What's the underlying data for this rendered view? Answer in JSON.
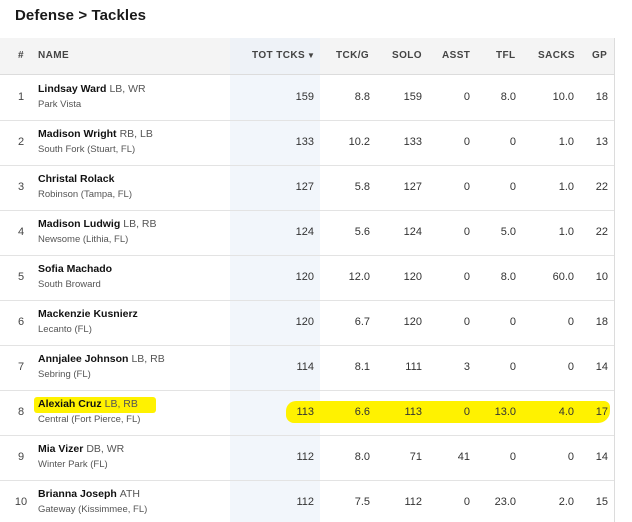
{
  "page": {
    "title": "Defense > Tackles"
  },
  "table": {
    "headers": {
      "rank": "#",
      "name": "NAME",
      "tot": "TOT TCKS",
      "sort_glyph": "▼",
      "tckg": "TCK/G",
      "solo": "SOLO",
      "asst": "ASST",
      "tfl": "TFL",
      "sacks": "SACKS",
      "gp": "GP"
    },
    "rows": [
      {
        "rank": "1",
        "name": "Lindsay Ward",
        "pos": "LB, WR",
        "school": "Park Vista",
        "tot": "159",
        "tckg": "8.8",
        "solo": "159",
        "asst": "0",
        "tfl": "8.0",
        "sacks": "10.0",
        "gp": "18"
      },
      {
        "rank": "2",
        "name": "Madison Wright",
        "pos": "RB, LB",
        "school": "South Fork (Stuart, FL)",
        "tot": "133",
        "tckg": "10.2",
        "solo": "133",
        "asst": "0",
        "tfl": "0",
        "sacks": "1.0",
        "gp": "13"
      },
      {
        "rank": "3",
        "name": "Christal Rolack",
        "pos": "",
        "school": "Robinson (Tampa, FL)",
        "tot": "127",
        "tckg": "5.8",
        "solo": "127",
        "asst": "0",
        "tfl": "0",
        "sacks": "1.0",
        "gp": "22"
      },
      {
        "rank": "4",
        "name": "Madison Ludwig",
        "pos": "LB, RB",
        "school": "Newsome (Lithia, FL)",
        "tot": "124",
        "tckg": "5.6",
        "solo": "124",
        "asst": "0",
        "tfl": "5.0",
        "sacks": "1.0",
        "gp": "22"
      },
      {
        "rank": "5",
        "name": "Sofia Machado",
        "pos": "",
        "school": "South Broward",
        "tot": "120",
        "tckg": "12.0",
        "solo": "120",
        "asst": "0",
        "tfl": "8.0",
        "sacks": "60.0",
        "gp": "10"
      },
      {
        "rank": "6",
        "name": "Mackenzie Kusnierz",
        "pos": "",
        "school": "Lecanto (FL)",
        "tot": "120",
        "tckg": "6.7",
        "solo": "120",
        "asst": "0",
        "tfl": "0",
        "sacks": "0",
        "gp": "18"
      },
      {
        "rank": "7",
        "name": "Annjalee Johnson",
        "pos": "LB, RB",
        "school": "Sebring (FL)",
        "tot": "114",
        "tckg": "8.1",
        "solo": "111",
        "asst": "3",
        "tfl": "0",
        "sacks": "0",
        "gp": "14"
      },
      {
        "rank": "8",
        "name": "Alexiah Cruz",
        "pos": "LB, RB",
        "school": "Central (Fort Pierce, FL)",
        "tot": "113",
        "tckg": "6.6",
        "solo": "113",
        "asst": "0",
        "tfl": "13.0",
        "sacks": "4.0",
        "gp": "17",
        "highlight": true
      },
      {
        "rank": "9",
        "name": "Mia Vizer",
        "pos": "DB, WR",
        "school": "Winter Park (FL)",
        "tot": "112",
        "tckg": "8.0",
        "solo": "71",
        "asst": "41",
        "tfl": "0",
        "sacks": "0",
        "gp": "14"
      },
      {
        "rank": "10",
        "name": "Brianna Joseph",
        "pos": "ATH",
        "school": "Gateway (Kissimmee, FL)",
        "tot": "112",
        "tckg": "7.5",
        "solo": "112",
        "asst": "0",
        "tfl": "23.0",
        "sacks": "2.0",
        "gp": "15"
      }
    ]
  },
  "colors": {
    "highlight": "#fff200",
    "header_bg": "#f4f4f4",
    "sorted_column_bg": "#f2f6fb"
  }
}
